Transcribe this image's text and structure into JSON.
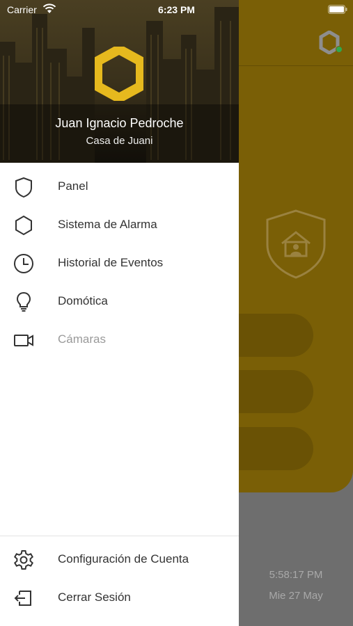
{
  "status_bar": {
    "carrier": "Carrier",
    "time": "6:23 PM"
  },
  "drawer": {
    "user_name": "Juan Ignacio Pedroche",
    "home_name": "Casa de Juani",
    "menu": [
      {
        "label": "Panel",
        "icon": "shield-icon"
      },
      {
        "label": "Sistema de Alarma",
        "icon": "hexagon-icon"
      },
      {
        "label": "Historial de Eventos",
        "icon": "clock-icon"
      },
      {
        "label": "Domótica",
        "icon": "lightbulb-icon"
      },
      {
        "label": "Cámaras",
        "icon": "video-camera-icon",
        "disabled": true
      }
    ],
    "footer": [
      {
        "label": "Configuración de Cuenta",
        "icon": "gear-icon"
      },
      {
        "label": "Cerrar Sesión",
        "icon": "logout-icon"
      }
    ]
  },
  "background": {
    "time": "5:58:17 PM",
    "date": "Mie 27 May"
  },
  "colors": {
    "brand_yellow": "#e6b91e",
    "dimmed_yellow": "#7a5f06",
    "online_green": "#2fa84f",
    "text_dark": "#333333",
    "text_disabled": "#9a9a9a"
  }
}
